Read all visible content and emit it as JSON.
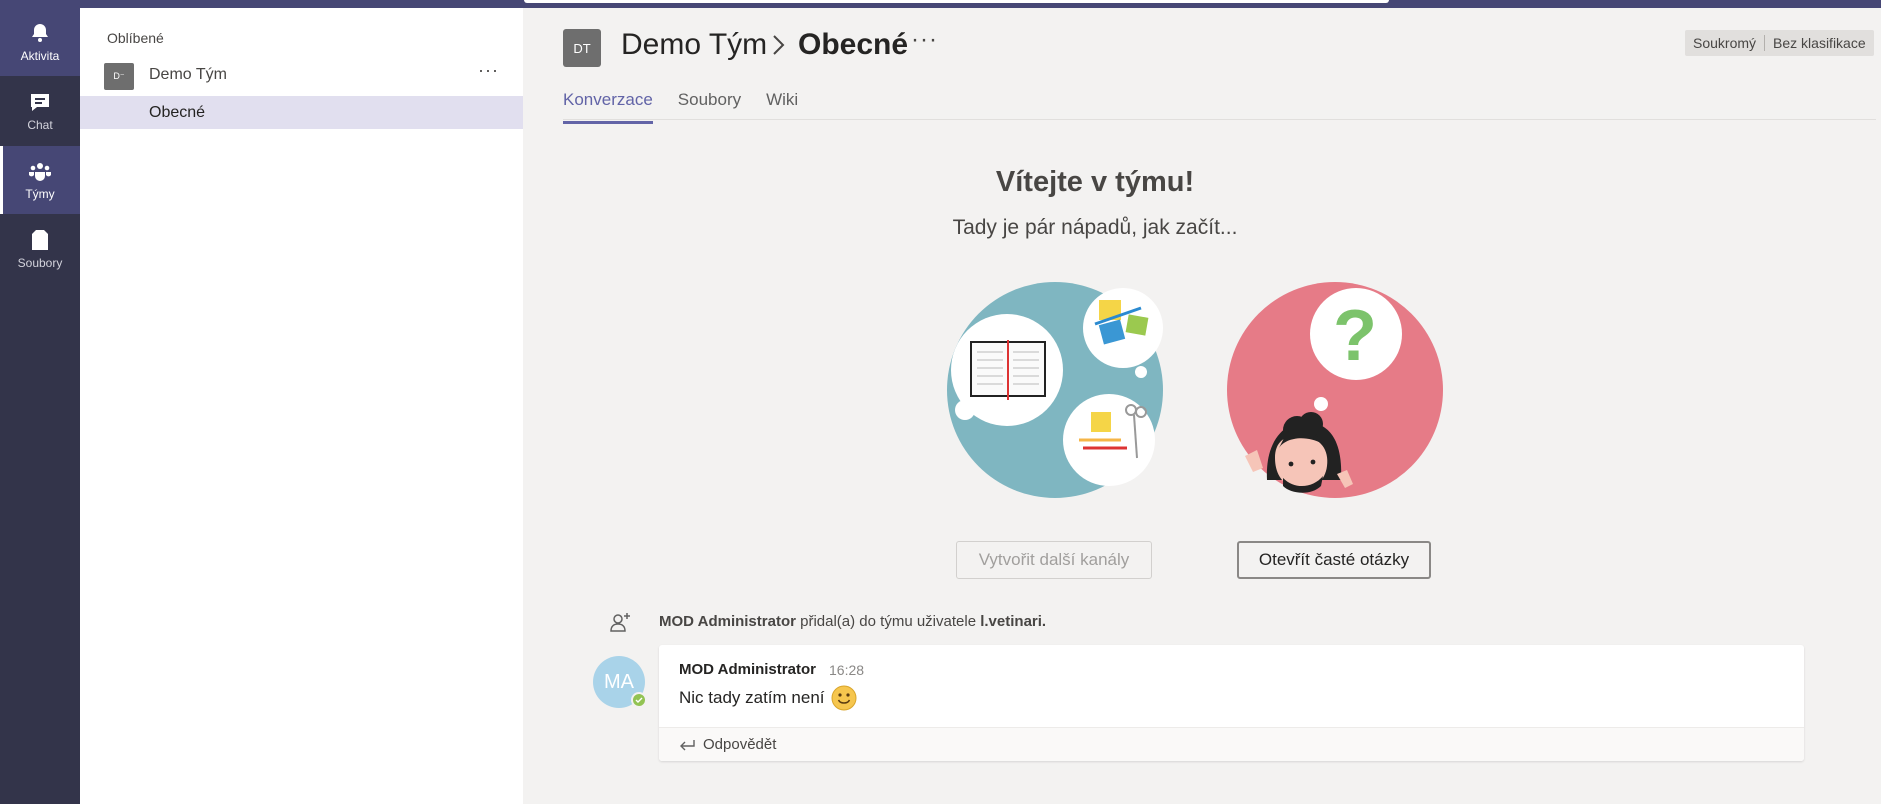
{
  "rail": {
    "items": [
      {
        "label": "Aktivita",
        "icon": "bell-icon"
      },
      {
        "label": "Chat",
        "icon": "chat-icon"
      },
      {
        "label": "Týmy",
        "icon": "teams-icon"
      },
      {
        "label": "Soubory",
        "icon": "files-icon"
      }
    ]
  },
  "teamlist": {
    "favorites_label": "Oblíbené",
    "team": {
      "avatar": "D⁻",
      "name": "Demo Tým",
      "more": "···"
    },
    "channel": {
      "name": "Obecné"
    }
  },
  "header": {
    "avatar": "DT",
    "team": "Demo Tým",
    "chevron": ">",
    "channel": "Obecné",
    "more": "···",
    "privacy": "Soukromý",
    "classification": "Bez klasifikace"
  },
  "tabs": [
    {
      "label": "Konverzace",
      "active": true
    },
    {
      "label": "Soubory",
      "active": false
    },
    {
      "label": "Wiki",
      "active": false
    }
  ],
  "welcome": {
    "title": "Vítejte v týmu!",
    "subtitle": "Tady je pár nápadů, jak začít...",
    "create_button": "Vytvořit další kanály",
    "faq_button": "Otevřít časté otázky"
  },
  "system_message": {
    "actor": "MOD Administrator",
    "text": "přidal(a) do týmu uživatele",
    "target": "l.vetinari."
  },
  "post": {
    "avatar": "MA",
    "author": "MOD Administrator",
    "time": "16:28",
    "text": "Nic tady zatím není",
    "reply_label": "Odpovědět"
  },
  "colors": {
    "rail_bg": "#33344a",
    "rail_active": "#464775",
    "accent": "#6264a7",
    "illu_teal": "#7fb6c1",
    "illu_pink": "#e67b87"
  }
}
